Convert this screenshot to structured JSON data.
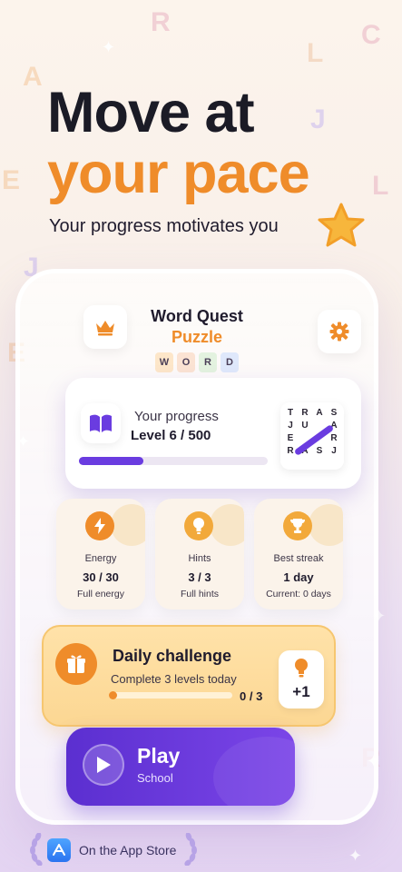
{
  "hero": {
    "line1": "Move at",
    "line2": "your pace",
    "subtitle": "Your progress motivates you"
  },
  "app": {
    "title": "Word Quest",
    "subtitle": "Puzzle",
    "tiles": [
      "W",
      "O",
      "R",
      "D"
    ],
    "tile_colors": [
      "#fde6c9",
      "#fbe3d3",
      "#e3f2df",
      "#dfe8fb"
    ],
    "crown_icon": "crown-icon",
    "settings_icon": "gear-icon"
  },
  "progress": {
    "label": "Your progress",
    "level": "Level 6 / 500",
    "fraction": 0.34,
    "grid": [
      [
        "T",
        "R",
        "A",
        "S"
      ],
      [
        "J",
        "U",
        "",
        "A"
      ],
      [
        "E",
        "",
        "",
        "R"
      ],
      [
        "R",
        "A",
        "S",
        "J"
      ]
    ]
  },
  "stats": [
    {
      "title": "Energy",
      "value": "30 / 30",
      "sub": "Full energy",
      "icon": "lightning-icon",
      "color": "#ef8c2a"
    },
    {
      "title": "Hints",
      "value": "3 / 3",
      "sub": "Full hints",
      "icon": "lightbulb-icon",
      "color": "#f2a93b"
    },
    {
      "title": "Best streak",
      "value": "1 day",
      "sub": "Current: 0 days",
      "icon": "trophy-icon",
      "color": "#f2a93b"
    }
  ],
  "daily": {
    "title": "Daily challenge",
    "subtitle": "Complete 3 levels today",
    "count": "0 / 3",
    "fraction": 0.0,
    "reward": "+1",
    "icon": "gift-icon"
  },
  "play": {
    "label": "Play",
    "sub": "School",
    "icon": "play-icon"
  },
  "store": {
    "label": "On the App Store",
    "icon": "app-store-icon"
  },
  "colors": {
    "accent_orange": "#ef8c2a",
    "accent_purple": "#6a3ce0"
  }
}
